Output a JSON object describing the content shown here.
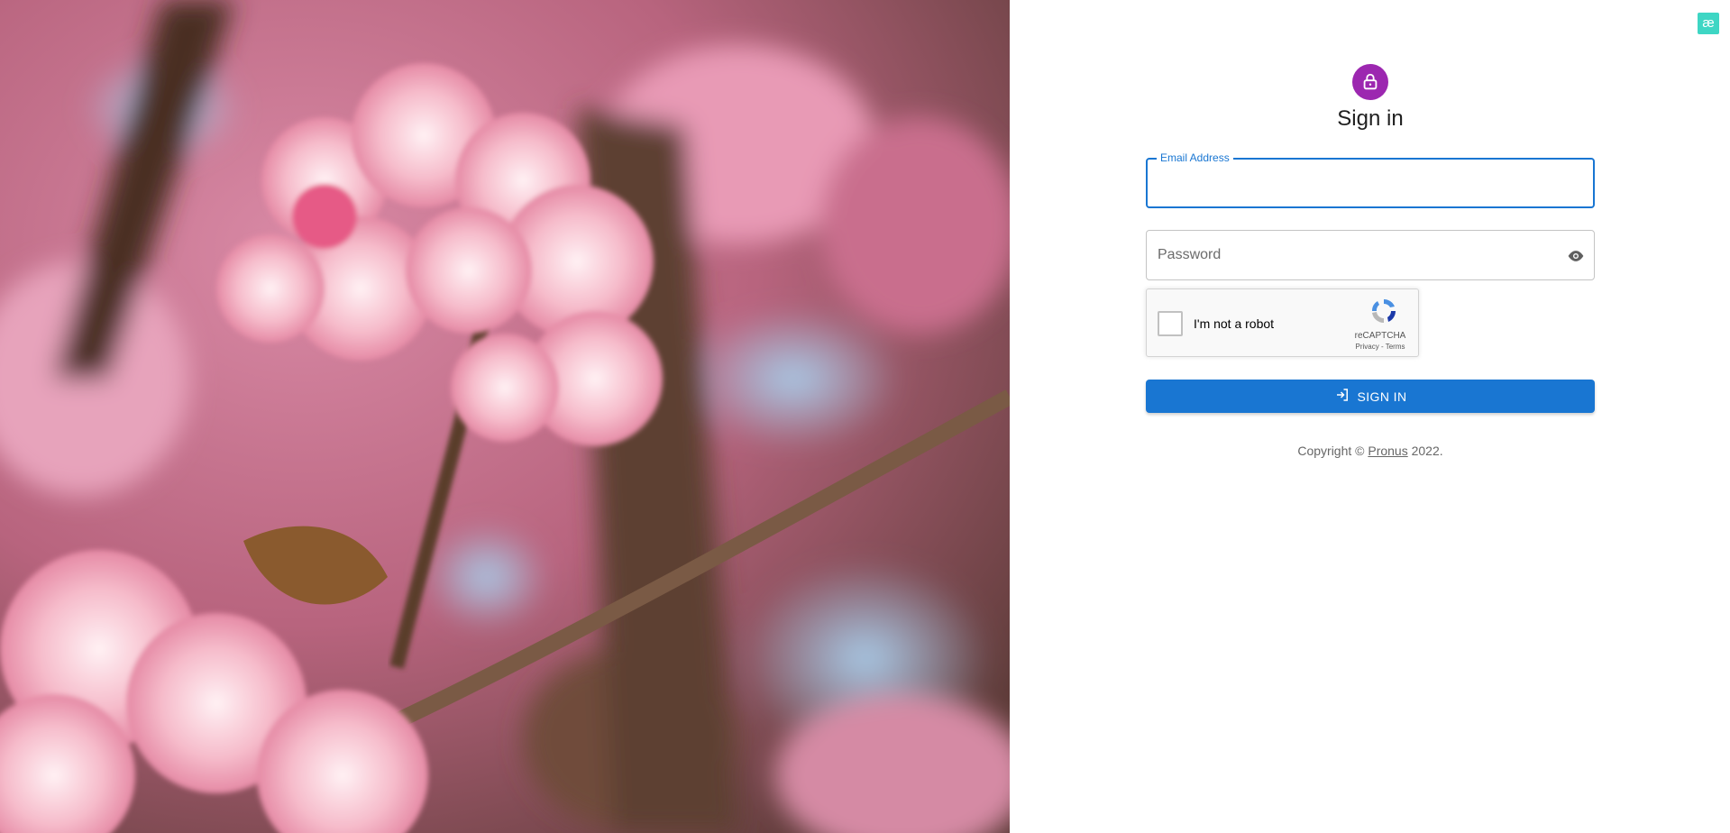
{
  "hero": {
    "image": "pink-cherry-blossom-branch-photo"
  },
  "corner_badge": {
    "glyph": "æ"
  },
  "form": {
    "icon": "lock-icon",
    "title": "Sign in",
    "email": {
      "label": "Email Address",
      "value": ""
    },
    "password": {
      "placeholder": "Password",
      "value": "",
      "toggle_icon": "eye-icon"
    },
    "captcha": {
      "label": "I'm not a robot",
      "brand": "reCAPTCHA",
      "privacy": "Privacy",
      "separator": " - ",
      "terms": "Terms"
    },
    "submit": {
      "label": "SIGN IN",
      "icon": "login-icon"
    },
    "copyright": {
      "prefix": "Copyright © ",
      "link": "Pronus",
      "suffix": " 2022."
    }
  },
  "colors": {
    "primary": "#1976d2",
    "avatar": "#9c27b0",
    "badge": "#3ed6c4"
  }
}
